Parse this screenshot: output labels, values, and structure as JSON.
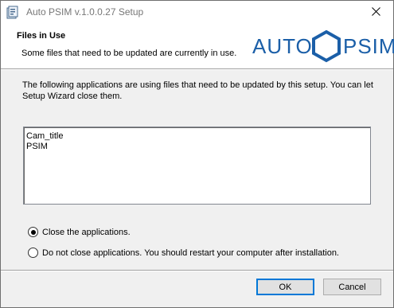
{
  "window": {
    "title": "Auto PSIM v.1.0.0.27 Setup",
    "icons": {
      "app": "installer-icon",
      "close": "close-icon"
    }
  },
  "header": {
    "title": "Files in Use",
    "description": "Some files that need to be updated are currently in use.",
    "logo": {
      "left_word": "AUTO",
      "right_word": "PSIM",
      "color": "#1b5fa8"
    }
  },
  "main": {
    "message": "The following applications are using files that need to be updated by this setup. You can let Setup Wizard close them.",
    "applications": [
      "Cam_title",
      "PSIM"
    ]
  },
  "options": {
    "selected": "close",
    "close_label": "Close the applications.",
    "noclose_label": "Do not close applications. You should restart your computer after installation."
  },
  "buttons": {
    "ok": "OK",
    "cancel": "Cancel"
  },
  "colors": {
    "accent": "#0078d7",
    "brand": "#1b5fa8"
  }
}
